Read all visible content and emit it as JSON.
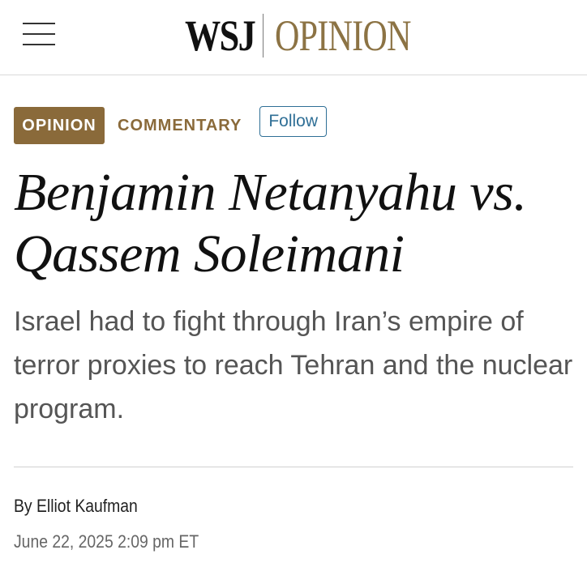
{
  "header": {
    "logo_wsj": "WSJ",
    "logo_section": "OPINION",
    "menu_icon": "hamburger-menu-icon"
  },
  "tags": {
    "section_badge": "OPINION",
    "subsection": "COMMENTARY",
    "follow_label": "Follow"
  },
  "article": {
    "headline_line1": "Benjamin Netanyahu vs.",
    "headline_line2": "Qassem Soleimani",
    "dek": "Israel had to fight through Iran’s empire of terror proxies to reach Tehran and the nuclear program.",
    "byline_prefix": "By ",
    "author": "Elliot Kaufman",
    "timestamp": "June 22, 2025 2:09 pm ET"
  },
  "colors": {
    "brand_gold": "#8a6a3a",
    "follow_blue": "#2f6f96",
    "dek_gray": "#555555"
  }
}
